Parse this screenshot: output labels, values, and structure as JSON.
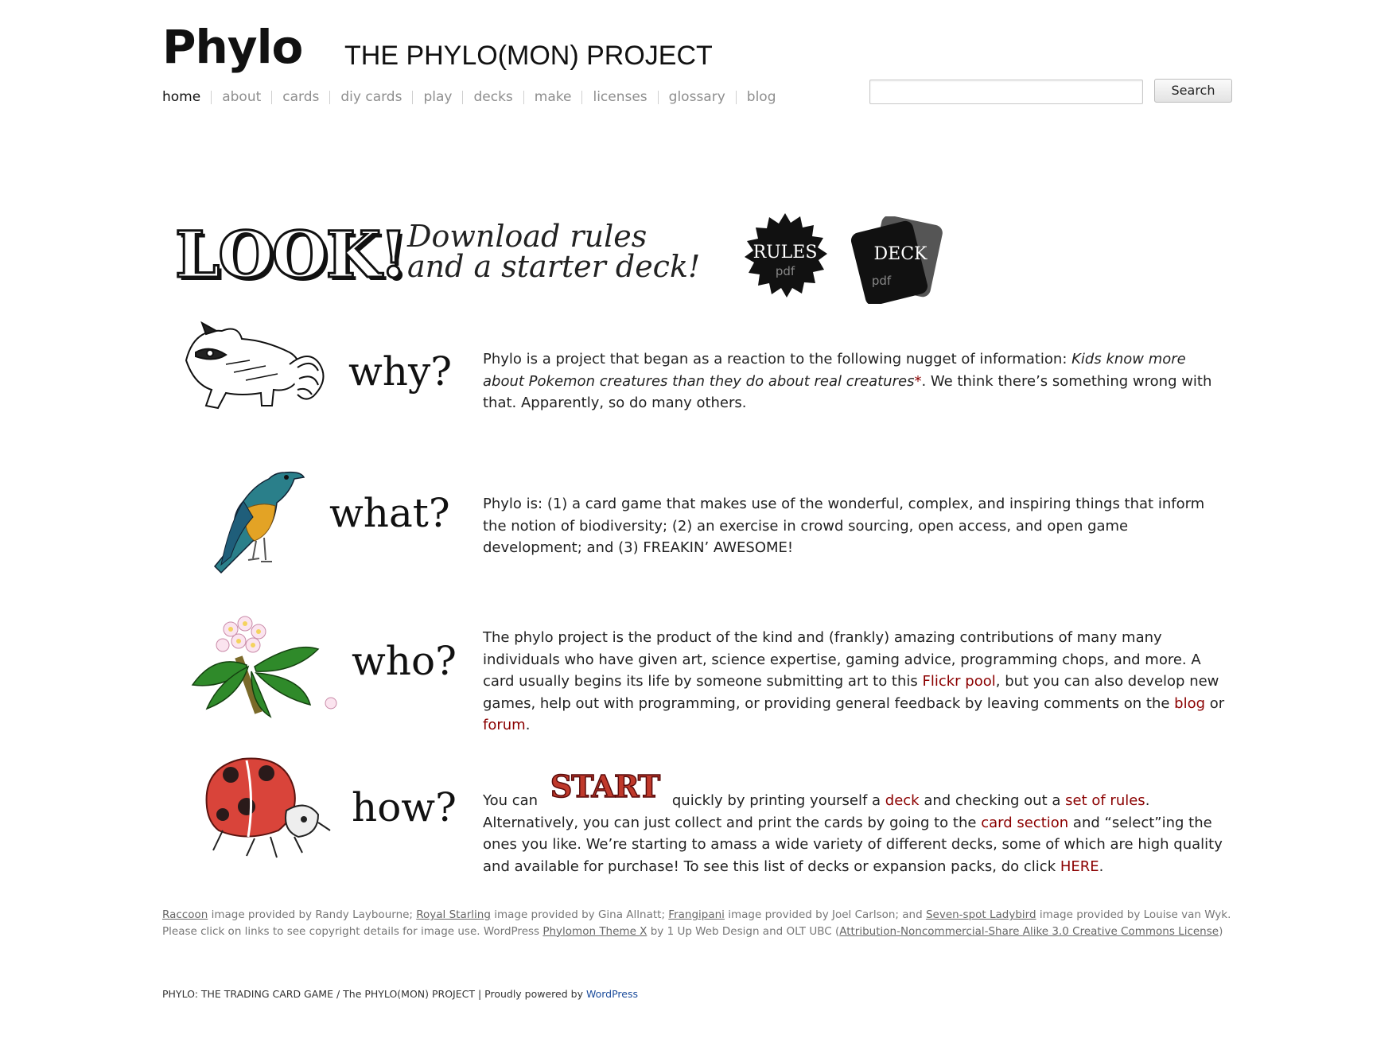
{
  "header": {
    "logo": "Phylo",
    "title": "THE PHYLO(MON) PROJECT"
  },
  "nav": [
    {
      "label": "home",
      "active": true
    },
    {
      "label": "about"
    },
    {
      "label": "cards"
    },
    {
      "label": "diy cards"
    },
    {
      "label": "play"
    },
    {
      "label": "decks"
    },
    {
      "label": "make"
    },
    {
      "label": "licenses"
    },
    {
      "label": "glossary"
    },
    {
      "label": "blog"
    }
  ],
  "search": {
    "value": "",
    "placeholder": "",
    "button": "Search"
  },
  "banner": {
    "look": "LOOK!",
    "download_line1": "Download rules",
    "download_line2": "and a starter deck!",
    "rules_label": "RULES",
    "rules_sub": "pdf",
    "deck_label": "DECK",
    "deck_sub": "pdf"
  },
  "sections": {
    "why": {
      "word": "why?",
      "t1": "Phylo is a project that began as a reaction to the following nugget of information: ",
      "t2": "Kids know more about Pokemon creatures than they do about real creatures",
      "t3": "*",
      "t4": ". We think there’s something wrong with that. Apparently, so do many others."
    },
    "what": {
      "word": "what?",
      "t1": "Phylo is: (1) a card game that makes use of the wonderful, complex, and inspiring things that inform the notion of biodiversity; (2) an exercise in crowd sourcing, open access, and open game development; and (3) FREAKIN’ AWESOME!"
    },
    "who": {
      "word": "who?",
      "t1": "The phylo project is the product of the kind and (frankly) amazing contributions of many many individuals who have given art, science expertise, gaming advice, programming chops, and more. A card usually begins its life by someone submitting art to this ",
      "l1": "Flickr pool",
      "t2": ", but you can also develop new games, help out with programming, or providing general feedback by leaving comments on the ",
      "l2": "blog",
      "t3": " or ",
      "l3": "forum",
      "t4": "."
    },
    "how": {
      "word": "how?",
      "t1": "You can ",
      "start": "START",
      "t2": " quickly by printing yourself a ",
      "l1": "deck",
      "t3": " and checking out a ",
      "l2": "set of rules",
      "t4": ". Alternatively, you can just collect and print the cards by going to the ",
      "l3": "card section",
      "t5": " and “select”ing the ones you like. We’re starting to amass a wide variety of different decks, some of which are high quality and available for purchase!  To see this list of decks or expansion packs, do click ",
      "l4": "HERE",
      "t6": "."
    }
  },
  "credits": {
    "a1": "Raccoon",
    "t1": " image provided by Randy Laybourne; ",
    "a2": "Royal Starling",
    "t2": " image provided by Gina Allnatt; ",
    "a3": "Frangipani",
    "t3": " image provided by Joel Carlson; and ",
    "a4": "Seven-spot Ladybird",
    "t4": " image provided by Louise van Wyk. Please click on links to see copyright details for image use. WordPress ",
    "a5": "Phylomon Theme X",
    "t5": " by 1 Up Web Design and OLT UBC (",
    "a6": "Attribution-Noncommercial-Share Alike 3.0 Creative Commons License",
    "t6": ")"
  },
  "footer": {
    "text": "PHYLO: THE TRADING CARD GAME / The PHYLO(MON) PROJECT | Proudly powered by ",
    "link": "WordPress"
  },
  "colors": {
    "link": "#8b0000",
    "nav": "#8e8e8e",
    "footer_link": "#1a4b9b"
  }
}
